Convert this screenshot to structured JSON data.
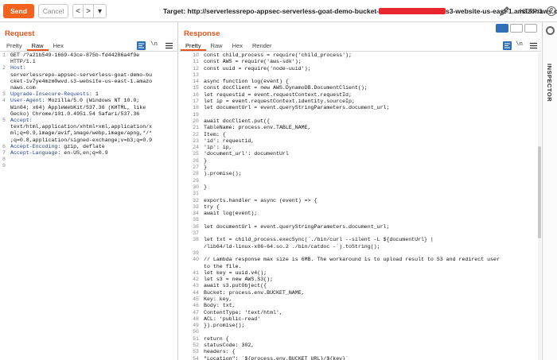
{
  "toolbar": {
    "send_label": "Send",
    "cancel_label": "Cancel",
    "nav_prev": "<",
    "nav_next": ">",
    "nav_dropdown": "▾",
    "target_prefix": "Target: http://serverlessrepo-appsec-serverless-goat-demo-bucket-",
    "target_suffix": "s3-website-us-east-1.amazonaws.com",
    "http_version": "HTTP/1",
    "help_label": "?"
  },
  "request": {
    "title": "Request",
    "tabs": [
      "Pretty",
      "Raw",
      "Hex"
    ],
    "active_tab": "Raw",
    "wrap_icon_text": "\\n",
    "lines": [
      {
        "n": "1",
        "key": "",
        "text": "GET /?a21b549-1669-43ce-875b-fd44286a4f9e"
      },
      {
        "n": "",
        "key": "",
        "text": "HTTP/1.1"
      },
      {
        "n": "2",
        "key": "Host:",
        "text": ""
      },
      {
        "n": "",
        "key": "",
        "text": "serverlessrepo-appsec-serverless-goat-demo-bu"
      },
      {
        "n": "",
        "key": "",
        "text": "cket-1v7ye4mzm0wvd.s3-website-us-east-1.amazo"
      },
      {
        "n": "",
        "key": "",
        "text": "naws.com"
      },
      {
        "n": "3",
        "key": "Upgrade-Insecure-Requests:",
        "text": " 1"
      },
      {
        "n": "4",
        "key": "User-Agent:",
        "text": " Mozilla/5.0 (Windows NT 10.0;"
      },
      {
        "n": "",
        "key": "",
        "text": "Win64; x64) AppleWebKit/537.36 (KHTML, like"
      },
      {
        "n": "",
        "key": "",
        "text": "Gecko) Chrome/101.0.4951.54 Safari/537.36"
      },
      {
        "n": "5",
        "key": "Accept:",
        "text": ""
      },
      {
        "n": "",
        "key": "",
        "text": "text/html,application/xhtml+xml,application/x"
      },
      {
        "n": "",
        "key": "",
        "text": "ml;q=0.9,image/avif,image/webp,image/apng,*/*"
      },
      {
        "n": "",
        "key": "",
        "text": ";q=0.8,application/signed-exchange;v=b3;q=0.9"
      },
      {
        "n": "6",
        "key": "Accept-Encoding:",
        "text": " gzip, deflate"
      },
      {
        "n": "7",
        "key": "Accept-Language:",
        "text": " en-US,en;q=0.9"
      },
      {
        "n": "8",
        "key": "",
        "text": ""
      },
      {
        "n": "9",
        "key": "",
        "text": ""
      }
    ]
  },
  "response": {
    "title": "Response",
    "tabs": [
      "Pretty",
      "Raw",
      "Hex",
      "Render"
    ],
    "active_tab": "Pretty",
    "wrap_icon_text": "\\n",
    "lines": [
      {
        "n": "10",
        "text": "const child_process = require('child_process');"
      },
      {
        "n": "11",
        "text": "const AWS = require('aws-sdk');"
      },
      {
        "n": "12",
        "text": "const uuid = require('node-uuid');"
      },
      {
        "n": "13",
        "text": ""
      },
      {
        "n": "14",
        "text": "async function log(event) {"
      },
      {
        "n": "15",
        "text": "const docClient = new AWS.DynamoDB.DocumentClient();"
      },
      {
        "n": "16",
        "text": "let requestid = event.requestContext.requestId;"
      },
      {
        "n": "17",
        "text": "let ip = event.requestContext.identity.sourceIp;"
      },
      {
        "n": "18",
        "text": "let documentUrl = event.queryStringParameters.document_url;"
      },
      {
        "n": "19",
        "text": ""
      },
      {
        "n": "20",
        "text": "await docClient.put({"
      },
      {
        "n": "21",
        "text": "TableName: process.env.TABLE_NAME,"
      },
      {
        "n": "22",
        "text": "Item: {"
      },
      {
        "n": "23",
        "text": "'id': requestid,"
      },
      {
        "n": "24",
        "text": "'ip': ip,"
      },
      {
        "n": "25",
        "text": "'document_url': documentUrl"
      },
      {
        "n": "26",
        "text": "}"
      },
      {
        "n": "27",
        "text": "}"
      },
      {
        "n": "28",
        "text": ").promise();"
      },
      {
        "n": "29",
        "text": ""
      },
      {
        "n": "30",
        "text": "}"
      },
      {
        "n": "31",
        "text": ""
      },
      {
        "n": "32",
        "text": "exports.handler = async (event) => {"
      },
      {
        "n": "33",
        "text": "try {"
      },
      {
        "n": "34",
        "text": "await log(event);"
      },
      {
        "n": "35",
        "text": ""
      },
      {
        "n": "36",
        "text": "let documentUrl = event.queryStringParameters.document_url;"
      },
      {
        "n": "37",
        "text": ""
      },
      {
        "n": "38",
        "text": "let txt = child_process.execSync(`./bin/curl --silent -L ${documentUrl} |"
      },
      {
        "n": "",
        "text": "/lib64/ld-linux-x86-64.so.2 ./bin/catdoc -`).toString();"
      },
      {
        "n": "39",
        "text": ""
      },
      {
        "n": "40",
        "text": "// Lambda response max size is 6MB. The workaround is to upload result to S3 and redirect user"
      },
      {
        "n": "",
        "text": "to the file."
      },
      {
        "n": "41",
        "text": "let key = uuid.v4();"
      },
      {
        "n": "42",
        "text": "let s3 = new AWS.S3();"
      },
      {
        "n": "43",
        "text": "await s3.putObject({"
      },
      {
        "n": "44",
        "text": "Bucket: process.env.BUCKET_NAME,"
      },
      {
        "n": "45",
        "text": "Key: key,"
      },
      {
        "n": "46",
        "text": "Body: txt,"
      },
      {
        "n": "47",
        "text": "ContentType: 'text/html',"
      },
      {
        "n": "48",
        "text": "ACL: 'public-read'"
      },
      {
        "n": "49",
        "text": "}).promise();"
      },
      {
        "n": "50",
        "text": ""
      },
      {
        "n": "51",
        "text": "return {"
      },
      {
        "n": "52",
        "text": "statusCode: 302,"
      },
      {
        "n": "53",
        "text": "headers: {"
      },
      {
        "n": "54",
        "text": "\"Location\": `${process.env.BUCKET_URL}/${key}`"
      }
    ]
  },
  "sidebar": {
    "inspector_label": "INSPECTOR"
  },
  "colors": {
    "accent": "#e8541b",
    "send": "#f3631f",
    "header_key": "#1f3f9a",
    "redaction": "#e8262e"
  }
}
